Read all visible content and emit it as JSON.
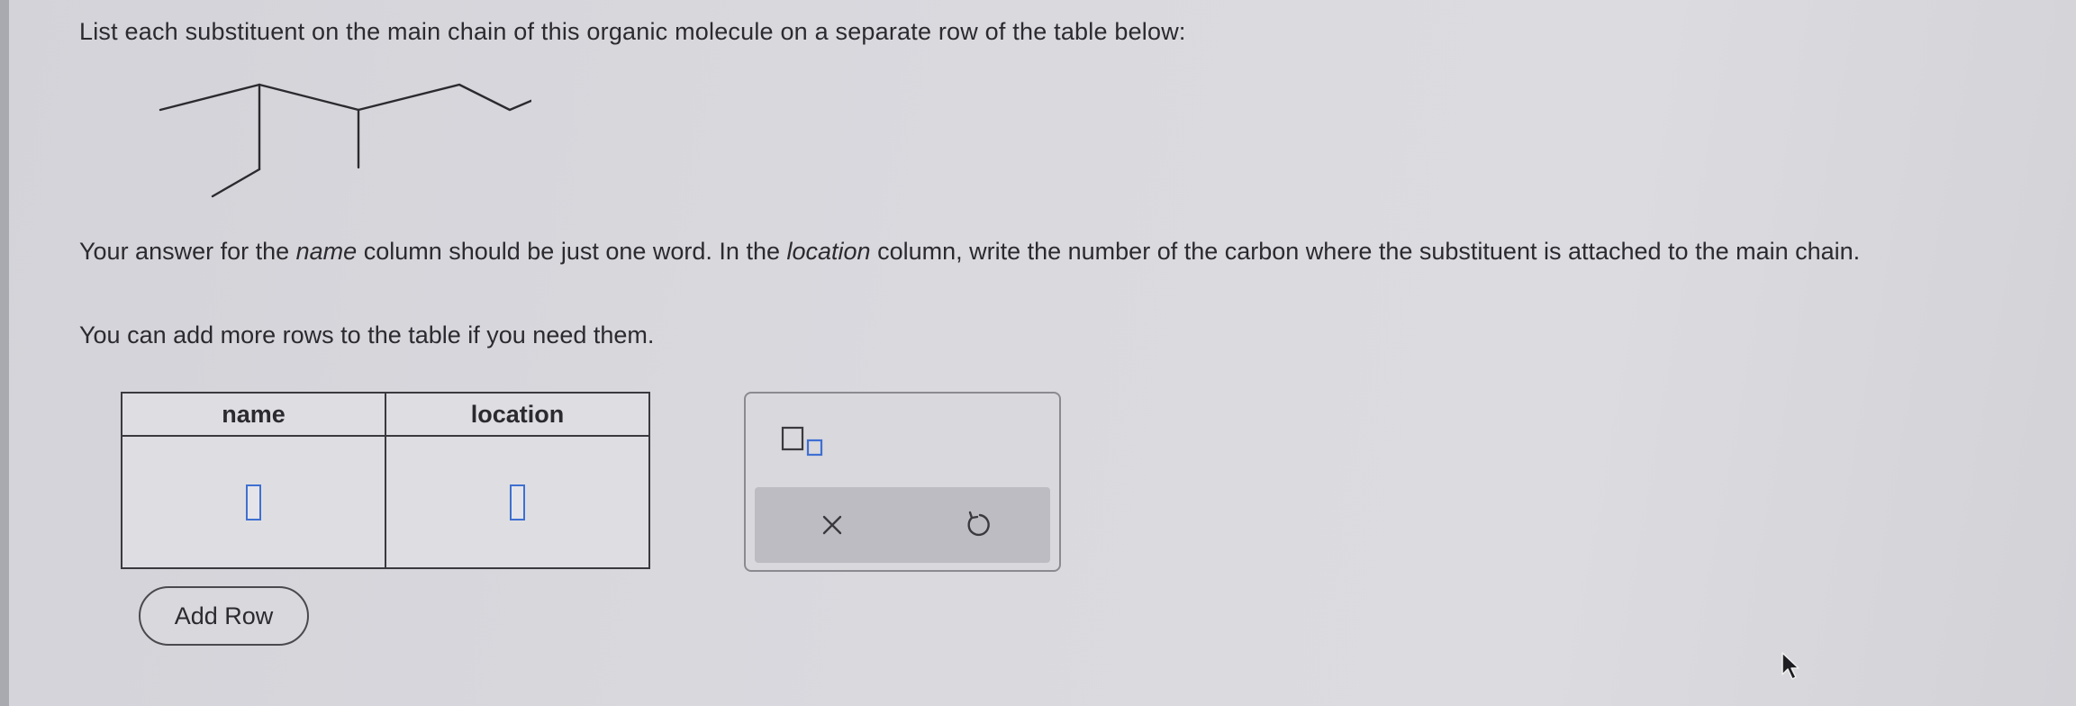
{
  "prompt": "List each substituent on the main chain of this organic molecule on a separate row of the table below:",
  "instructions": {
    "part1": "Your answer for the ",
    "name_word": "name",
    "part2": " column should be just one word. In the ",
    "location_word": "location",
    "part3": " column, write the number of the carbon where the substituent is attached to the main chain."
  },
  "more_rows_note": "You can add more rows to the table if you need them.",
  "table": {
    "headers": [
      "name",
      "location"
    ],
    "rows": [
      {
        "name": "",
        "location": ""
      }
    ]
  },
  "add_row_label": "Add Row",
  "toolbox": {
    "template_icon": "box-with-subscript-icon",
    "clear_icon": "x-icon",
    "undo_icon": "undo-icon"
  },
  "colors": {
    "input_slot_border": "#3f6fd1",
    "text": "#2b2b2f",
    "action_bar": "#bcbcc2"
  }
}
